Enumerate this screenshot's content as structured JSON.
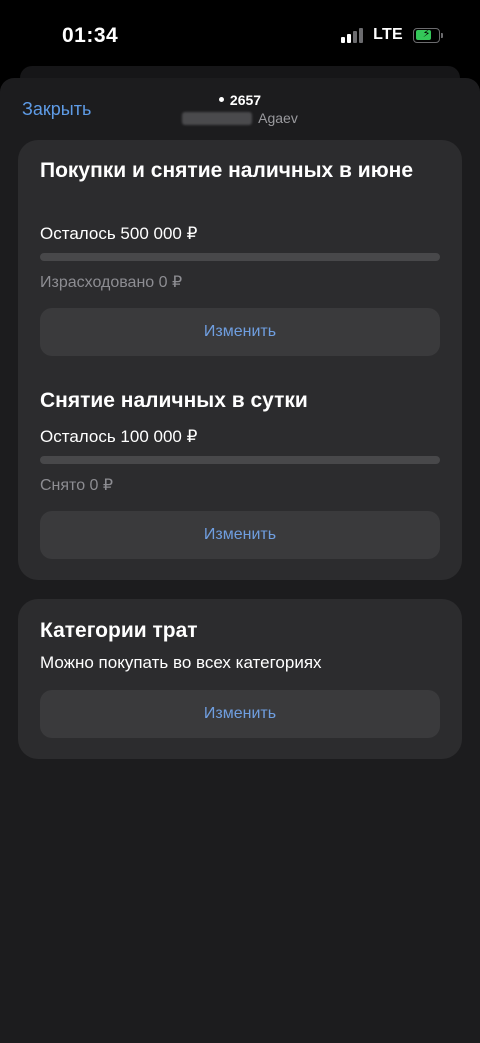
{
  "status_bar": {
    "time": "01:34",
    "network": "LTE",
    "battery_charging": true
  },
  "header": {
    "close_label": "Закрыть",
    "card_number": "2657",
    "owner_name": "Agaev"
  },
  "limits": [
    {
      "title": "Покупки и снятие наличных в июне",
      "remaining": "Осталось 500 000 ₽",
      "used": "Израсходовано 0 ₽",
      "used_fraction": 0,
      "button_label": "Изменить"
    },
    {
      "title": "Снятие наличных в сутки",
      "remaining": "Осталось 100 000 ₽",
      "used": "Снято 0 ₽",
      "used_fraction": 0,
      "button_label": "Изменить"
    }
  ],
  "categories": {
    "title": "Категории трат",
    "description": "Можно покупать во всех категориях",
    "button_label": "Изменить"
  },
  "colors": {
    "accent": "#5e9be6",
    "background": "#1c1c1e",
    "card": "#2c2c2e",
    "battery": "#34c759"
  },
  "icons": [
    "signal-icon",
    "battery-charging-icon"
  ]
}
